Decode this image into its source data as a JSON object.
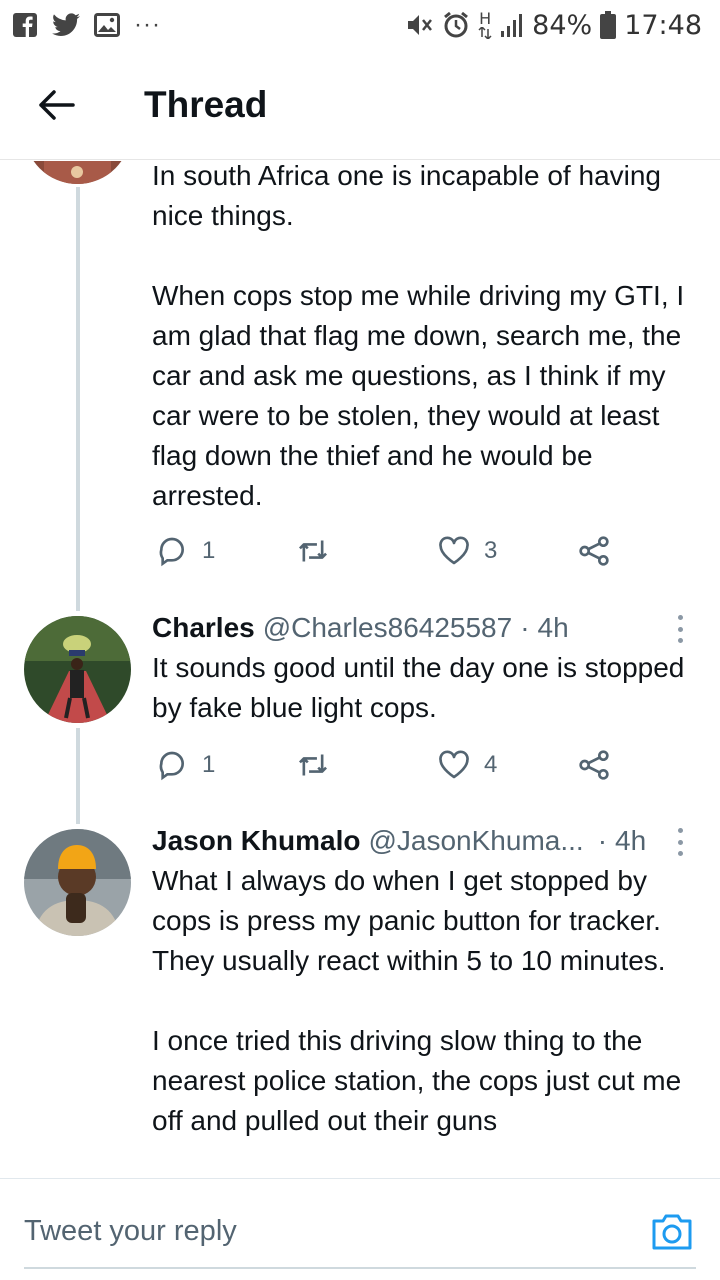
{
  "status_bar": {
    "left_icons": [
      "facebook-icon",
      "twitter-icon",
      "gallery-icon",
      "more-notifications-icon"
    ],
    "more_label": "···",
    "right_icons": [
      "mute-icon",
      "alarm-icon",
      "hplus-icon",
      "signal-icon",
      "battery-icon"
    ],
    "network": "H",
    "battery": "84%",
    "time": "17:48"
  },
  "header": {
    "back_icon": "arrow-left-icon",
    "title": "Thread"
  },
  "tweets": [
    {
      "paragraphs": [
        "In south Africa one is incapable of having nice things.",
        "When cops stop me while driving my GTI, I am glad that flag me down, search me, the car and ask me questions, as I think if my car were to be stolen, they would at least flag down the thief and he would be arrested."
      ],
      "replies": "1",
      "retweets": "",
      "likes": "3"
    },
    {
      "name": "Charles",
      "handle": "@Charles86425587",
      "separator": "·",
      "time": "4h",
      "text": "It sounds good until the day one is stopped by fake blue light cops.",
      "replies": "1",
      "retweets": "",
      "likes": "4"
    },
    {
      "name": "Jason Khumalo",
      "handle": "@JasonKhuma...",
      "separator": "·",
      "time": "4h",
      "paragraphs": [
        "What I always do when I get stopped by cops is press my panic button for tracker. They usually react within 5 to 10 minutes.",
        "I once tried this driving slow thing to the nearest police station, the cops just cut me off and pulled out their guns"
      ]
    }
  ],
  "reply_bar": {
    "placeholder": "Tweet your reply",
    "camera_icon": "camera-icon"
  },
  "colors": {
    "text": "#0f1419",
    "secondary": "#536471",
    "thread_line": "#cfd9de",
    "accent": "#1d9bf0"
  }
}
